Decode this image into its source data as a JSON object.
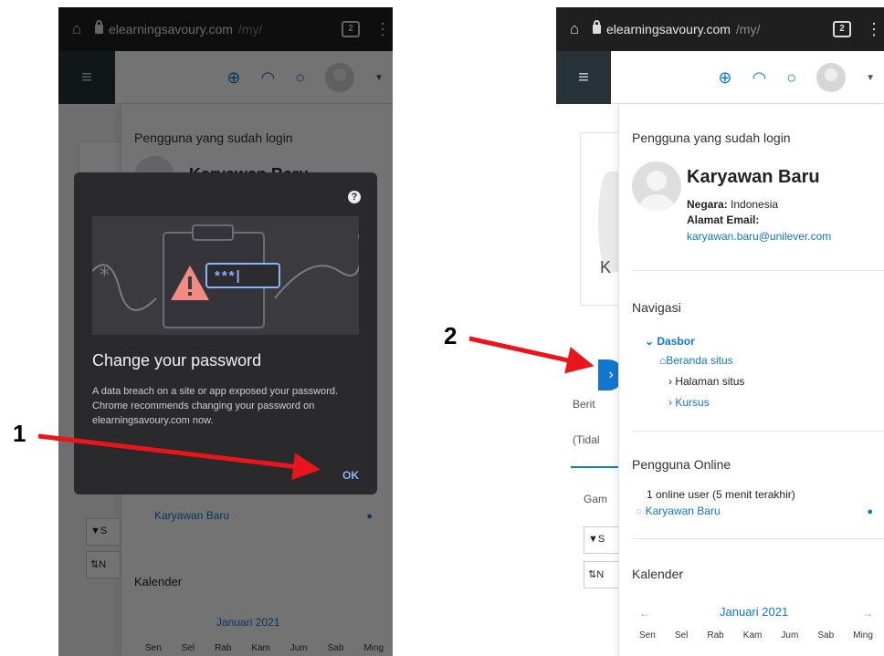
{
  "browser": {
    "url_host": "elearningsavoury.com",
    "url_path": "/my/",
    "tab_count": "2"
  },
  "dialog": {
    "title": "Change your password",
    "body": "A data breach on a site or app exposed your password. Chrome recommends changing your password on elearningsavoury.com now.",
    "ok_label": "OK",
    "password_mask": "***|"
  },
  "drawer": {
    "logged_in_title": "Pengguna yang sudah login",
    "user_name": "Karyawan Baru",
    "country_label": "Negara:",
    "country_value": "Indonesia",
    "email_label": "Alamat Email:",
    "email_value": "karyawan.baru@unilever.com",
    "nav_title": "Navigasi",
    "nav_items": {
      "dashboard": "Dasbor",
      "site_home": "Beranda situs",
      "site_pages": "Halaman situs",
      "courses": "Kursus"
    },
    "online_title": "Pengguna Online",
    "online_summary": "1 online user (5 menit terakhir)",
    "online_user": "Karyawan Baru",
    "calendar_title": "Kalender",
    "calendar_month": "Januari 2021",
    "weekdays": [
      "Sen",
      "Sel",
      "Rab",
      "Kam",
      "Jum",
      "Sab",
      "Ming"
    ]
  },
  "background": {
    "left_k": "K",
    "berita": "Berit",
    "tidak": "(Tidal",
    "gam": "Gam",
    "filter_s": "S",
    "sort_n": "N"
  },
  "annotations": {
    "step1": "1",
    "step2": "2"
  },
  "colors": {
    "accent": "#1177d1",
    "arrow": "#e8161b"
  }
}
